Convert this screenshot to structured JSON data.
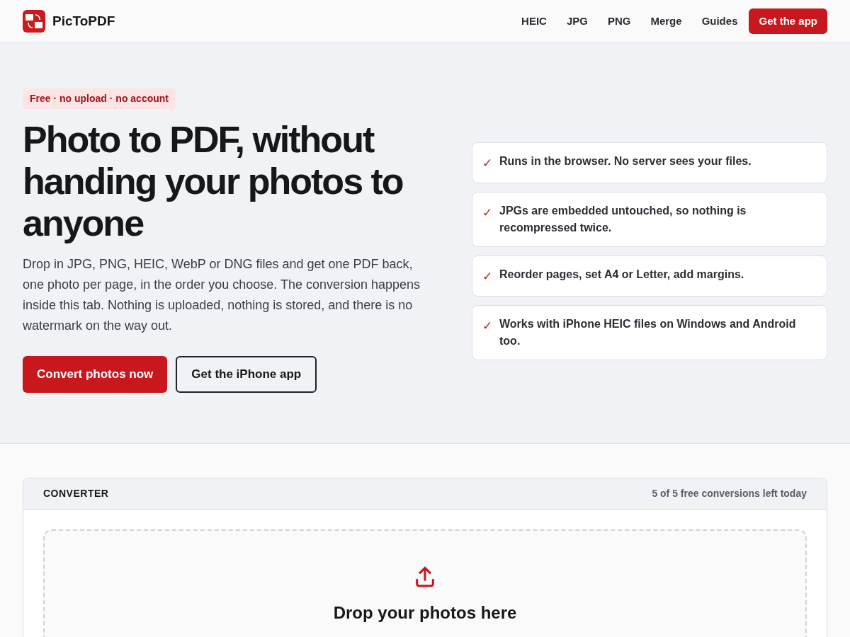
{
  "header": {
    "brand": "PicToPDF",
    "nav": [
      "HEIC",
      "JPG",
      "PNG",
      "Merge",
      "Guides"
    ],
    "cta": "Get the app"
  },
  "hero": {
    "badge": "Free · no upload · no account",
    "title": "Photo to PDF, without handing your photos to anyone",
    "intro": "Drop in JPG, PNG, HEIC, WebP or DNG files and get one PDF back, one photo per page, in the order you choose. The conversion happens inside this tab. Nothing is uploaded, nothing is stored, and there is no watermark on the way out.",
    "buttons": [
      {
        "label": "Convert photos now",
        "kind": "primary"
      },
      {
        "label": "Get the iPhone app",
        "kind": "outline"
      }
    ],
    "features": [
      {
        "mark": "✓",
        "text": "Runs in the browser. No server sees your files."
      },
      {
        "mark": "✓",
        "text": "JPGs are embedded untouched, so nothing is recompressed twice."
      },
      {
        "mark": "✓",
        "text": "Reorder pages, set A4 or Letter, add margins."
      },
      {
        "mark": "✓",
        "text": "Works with iPhone HEIC files on Windows and Android too."
      }
    ]
  },
  "converter": {
    "title": "CONVERTER",
    "quota": "5 of 5 free conversions left today",
    "dropzone": {
      "heading": "Drop your photos here"
    }
  }
}
